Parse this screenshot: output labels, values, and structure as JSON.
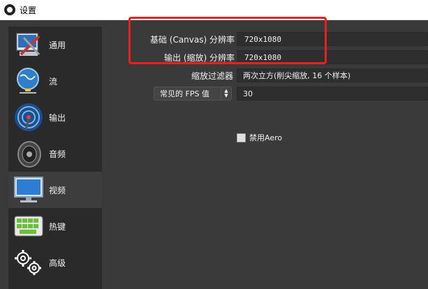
{
  "window": {
    "title": "设置"
  },
  "sidebar": {
    "items": [
      {
        "label": "通用",
        "icon": "general-settings-icon"
      },
      {
        "label": "流",
        "icon": "stream-globe-icon"
      },
      {
        "label": "输出",
        "icon": "output-broadcast-icon"
      },
      {
        "label": "音频",
        "icon": "audio-speaker-icon"
      },
      {
        "label": "视频",
        "icon": "video-monitor-icon",
        "active": true
      },
      {
        "label": "热键",
        "icon": "hotkeys-keyboard-icon"
      },
      {
        "label": "高级",
        "icon": "advanced-gears-icon"
      }
    ]
  },
  "video": {
    "base_resolution_label": "基础 (Canvas) 分辨率",
    "base_resolution_value": "720x1080",
    "output_resolution_label": "输出 (缩放) 分辨率",
    "output_resolution_value": "720x1080",
    "downscale_filter_label": "缩放过滤器",
    "downscale_filter_value": "两次立方(削尖缩放, 16 个样本)",
    "fps_type_label": "常见的 FPS 值",
    "fps_value": "30",
    "disable_aero_label": "禁用Aero"
  },
  "colors": {
    "highlight": "#e8211e",
    "background": "#3a3a3a",
    "sidebar": "#2a2a2a"
  }
}
